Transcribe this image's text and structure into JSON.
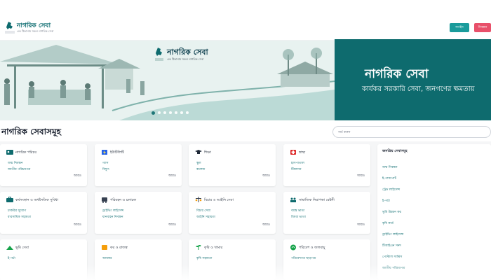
{
  "header": {
    "brand_title": "নাগরিক সেবা",
    "brand_sub": "এক ঠিকানায় সকল নাগরিক সেবা",
    "login_label": "লগইন",
    "register_label": "নিবন্ধন"
  },
  "banner": {
    "brand_title": "নাগরিক সেবা",
    "brand_sub": "এক ঠিকানায় সকল নাগরিক সেবা",
    "heading": "নাগরিক সেবা",
    "subheading": "কার্যকর সরকারি সেবা, জনগণের ক্ষমতায়"
  },
  "services": {
    "title": "নাগরিক সেবাসমূহ",
    "search_placeholder": "সার্চ করুন",
    "more_label": "আরও",
    "cards": [
      {
        "title": "নাগরিক পরিচয়",
        "items": [
          "জন্ম নিবন্ধন",
          "জাতীয় পরিচয়পত্র"
        ]
      },
      {
        "title": "ইউটিলিটি",
        "items": [
          "গ্যাস",
          "বিদ্যুৎ"
        ]
      },
      {
        "title": "শিক্ষা",
        "items": [
          "স্কুল",
          "কলেজ"
        ]
      },
      {
        "title": "স্বাস্থ্য",
        "items": [
          "হাসপাতাল",
          "টিকাদান"
        ]
      },
      {
        "title": "কর্মসংস্থান ও অর্থনৈতিক সুবিধা",
        "items": [
          "চাকরির সুযোগ",
          "ব্যবসায়িক সহায়তা"
        ]
      },
      {
        "title": "পরিবহন ও চলাচল",
        "items": [
          "ড্রাইভিং লাইসেন্স",
          "যানবাহন নিবন্ধন"
        ]
      },
      {
        "title": "বিচার ও আইনি সেবা",
        "items": [
          "বিচার সেবা",
          "আইনি সহায়তা"
        ]
      },
      {
        "title": "সামাজিক নিরাপত্তা বেষ্টনী",
        "items": [
          "বয়স্ক ভাতা",
          "বিধবা ভাতা"
        ]
      },
      {
        "title": "ভূমি সেবা",
        "items": [
          "ই-পর্চা"
        ]
      },
      {
        "title": "কর ও রাজস্ব",
        "items": [
          "আয়কর"
        ]
      },
      {
        "title": "কৃষি ও খামার",
        "items": [
          "কৃষি সহায়তা"
        ]
      },
      {
        "title": "পরিবেশ ও জলবায়ু",
        "items": [
          "পরিবেশগত ছাড়পত্র"
        ]
      }
    ],
    "popular_title": "জনপ্রিয় সেবাসমূহ",
    "popular": [
      "জন্ম নিবন্ধন",
      "ই-পাসপোর্ট",
      "ট্রেড লাইসেন্স",
      "ই-পর্চা",
      "ভূমি উন্নয়ন কর",
      "কৃষি কার্ড",
      "ড্রাইভিং লাইসেন্স",
      "টিআইএন সনদ",
      "পোস্টাল সার্ভিস",
      "জাতীয় পরিচয়পত্র"
    ]
  }
}
